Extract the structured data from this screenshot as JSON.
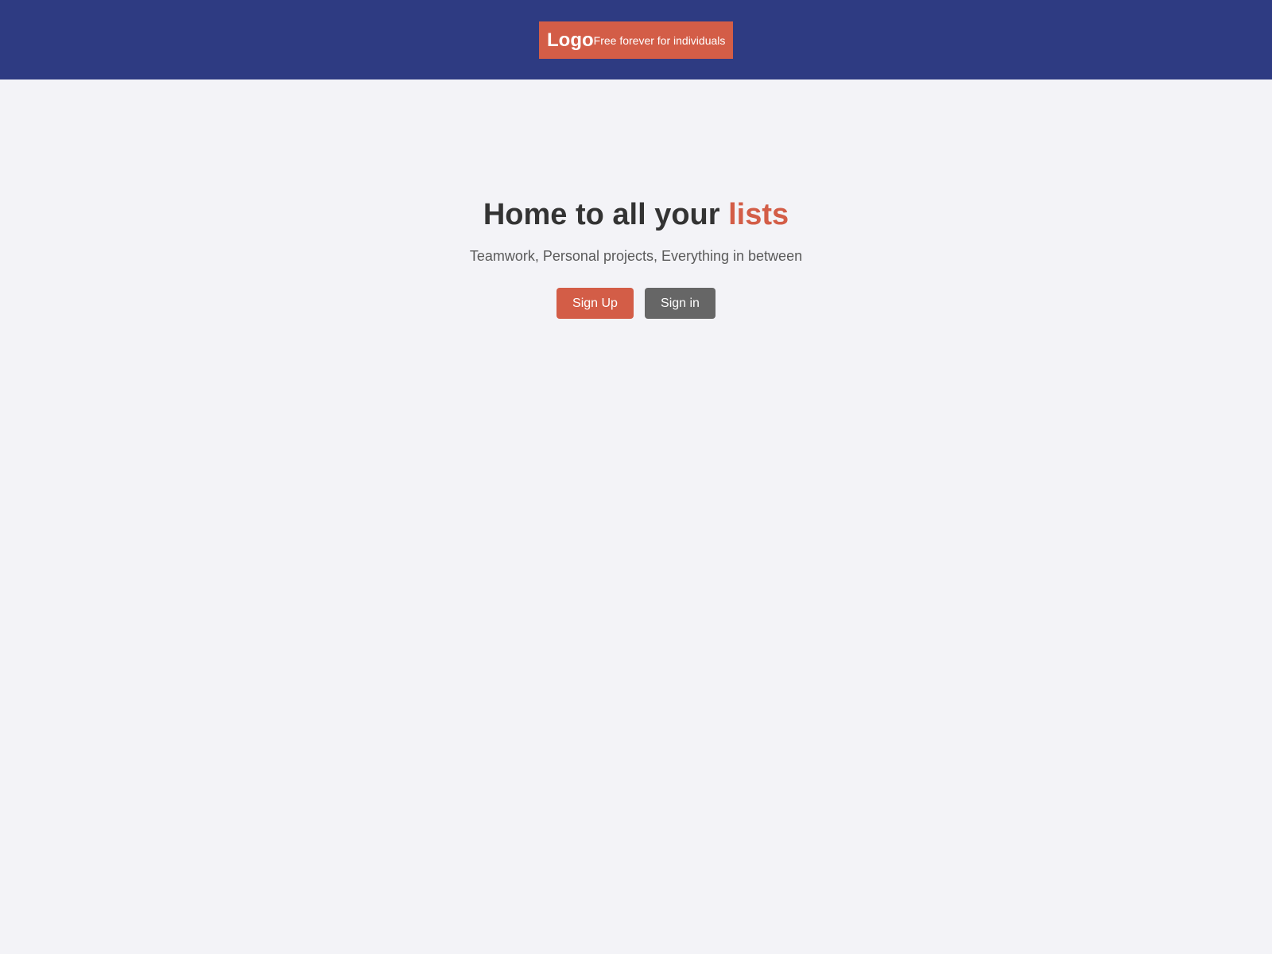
{
  "header": {
    "logo_text": "Logo",
    "tagline": "Free forever for individuals"
  },
  "hero": {
    "title_main": "Home to all your ",
    "title_accent": "lists",
    "subtitle": "Teamwork, Personal projects, Everything in between"
  },
  "actions": {
    "signup_label": "Sign Up",
    "signin_label": "Sign in"
  },
  "colors": {
    "header_bg": "#2e3b82",
    "brand_bg": "#d35d47",
    "accent": "#d35d47",
    "page_bg": "#f3f3f7",
    "secondary_button": "#666666",
    "title_text": "#333333",
    "subtitle_text": "#5a5a5a"
  }
}
